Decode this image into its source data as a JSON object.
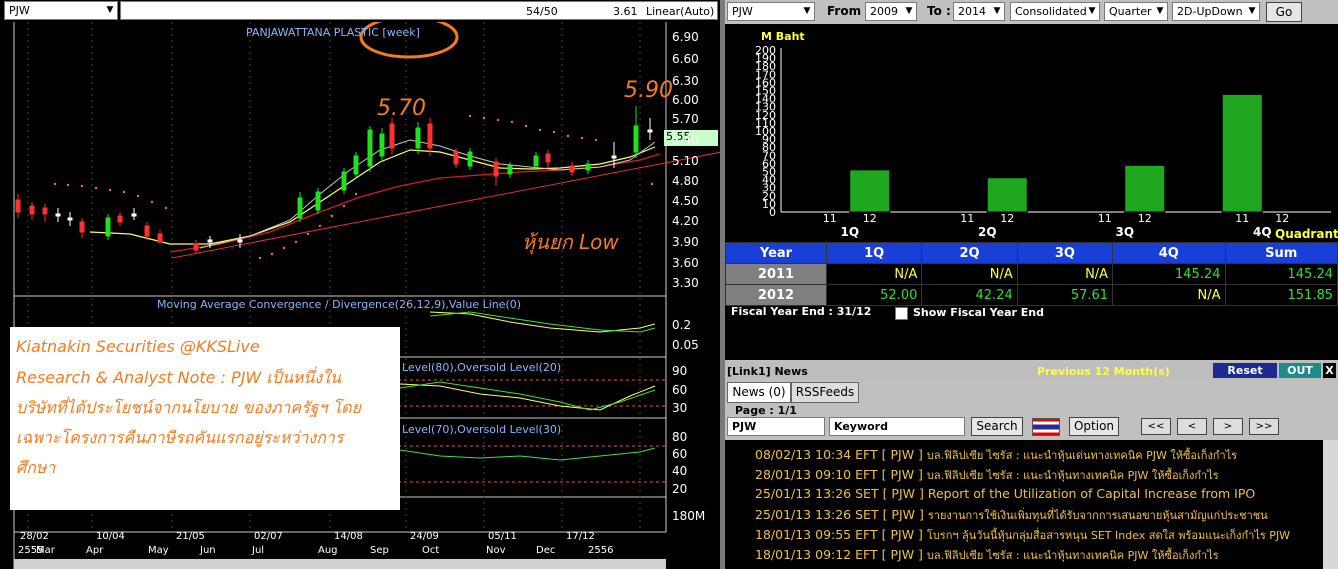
{
  "left": {
    "symbol": "PJW",
    "ratio": "54/50",
    "last": "3.61",
    "scale": "Linear(Auto)",
    "chart_title": "PANJAWATTANA PLASTIC [week]",
    "ann_high1": "5.70",
    "ann_high2": "5.90",
    "ann_low": "หุ้นยก Low",
    "current_price_tag": "5.55",
    "price_ticks": [
      "6.90",
      "6.60",
      "6.30",
      "6.00",
      "5.70",
      "5.40",
      "5.10",
      "4.80",
      "4.50",
      "4.20",
      "3.90",
      "3.60",
      "3.30"
    ],
    "macd_title": "Moving Average Convergence / Divergence(26,12,9),Value Line(0)",
    "macd_ticks": [
      "0.2",
      "0.05"
    ],
    "stoch_title": "Level(80),Oversold Level(20)",
    "stoch_ticks": [
      "90",
      "60",
      "30"
    ],
    "rsi_title": "Level(70),Oversold Level(30)",
    "rsi_ticks": [
      "80",
      "60",
      "40",
      "20"
    ],
    "vol_tick": "180M",
    "date_labels": [
      "28/02",
      "10/04",
      "21/05",
      "02/07",
      "14/08",
      "24/09",
      "05/11",
      "17/12",
      "2556"
    ],
    "month_labels": [
      "2555",
      "Mar",
      "Apr",
      "May",
      "Jun",
      "Jul",
      "Aug",
      "Sep",
      "Oct",
      "Nov",
      "Dec",
      "2556"
    ],
    "note": {
      "line1": "Kiatnakin Securities @KKSLive",
      "line2": "Research & Analyst Note : PJW เป็นหนึ่งใน",
      "line3": "บริษัทที่ได้ประโยชน์จากนโยบาย ของภาครัฐฯ โดย",
      "line4": "เฉพาะโครงการคืนภาษีรถคันแรกอยู่ระหว่างการ",
      "line5": "ศึกษา"
    }
  },
  "right": {
    "toolbar": {
      "symbol": "PJW",
      "from_label": "From :",
      "from_value": "2009",
      "to_label": "To :",
      "to_value": "2014",
      "consolidated": "Consolidated",
      "period": "Quarter",
      "mode": "2D-UpDown",
      "go": "Go"
    },
    "chart_unit": "M Baht",
    "quadrant_label": "Quadrant",
    "year_tick_labels": [
      "11",
      "12"
    ],
    "table": {
      "headers": [
        "Year",
        "1Q",
        "2Q",
        "3Q",
        "4Q",
        "Sum"
      ],
      "rows": [
        {
          "year": "2011",
          "q1": "N/A",
          "q2": "N/A",
          "q3": "N/A",
          "q4": "145.24",
          "sum": "145.24"
        },
        {
          "year": "2012",
          "q1": "52.00",
          "q2": "42.24",
          "q3": "57.61",
          "q4": "N/A",
          "sum": "151.85"
        }
      ]
    },
    "fiscal_label": "Fiscal Year End : 31/12",
    "show_fiscal": "Show Fiscal Year End",
    "news": {
      "title": "[Link1] News",
      "previous": "Previous 12 Month(s)",
      "reset": "Reset",
      "out": "OUT",
      "close": "X",
      "tab_news": "News (0)",
      "tab_rss": "RSSFeeds",
      "page": "Page : 1/1",
      "symbol": "PJW",
      "keyword": "Keyword",
      "search": "Search",
      "option": "Option",
      "items": [
        {
          "date": "08/02/13 10:34",
          "src": "EFT",
          "sym": "[ PJW ]",
          "text": "บล.ฟิลิปเซีย ไซรัส : แนะนำหุ้นเด่นทางเทคนิค PJW ให้ซื้อเก็งกำไร"
        },
        {
          "date": "28/01/13 09:10",
          "src": "EFT",
          "sym": "[ PJW ]",
          "text": "บล.ฟิลิปเซีย ไซรัส : แนะนำหุ้นทางเทคนิค PJW ให้ซื้อเก็งกำไร"
        },
        {
          "date": "25/01/13 13:26",
          "src": "SET",
          "sym": "[ PJW ]",
          "text": "Report of the Utilization of Capital Increase from IPO"
        },
        {
          "date": "25/01/13 13:26",
          "src": "SET",
          "sym": "[ PJW ]",
          "text": "รายงานการใช้เงินเพิ่มทุนที่ได้รับจากการเสนอขายหุ้นสามัญแก่ประชาชน"
        },
        {
          "date": "18/01/13 09:55",
          "src": "EFT",
          "sym": "[ PJW ]",
          "text": "โบรกฯ ลุ้นวันนี้หุ้นกลุ่มสื่อสารหนุน SET Index สดใส พร้อมแนะเก็งกำไร PJW"
        },
        {
          "date": "18/01/13 09:12",
          "src": "EFT",
          "sym": "[ PJW ]",
          "text": "บล.ฟิลิปเซีย ไซรัส : แนะนำหุ้นทางเทคนิค PJW ให้ซื้อเก็งกำไร"
        }
      ]
    }
  },
  "chart_data": {
    "type": "bar",
    "categories": [
      "1Q",
      "2Q",
      "3Q",
      "4Q"
    ],
    "series": [
      {
        "name": "11",
        "values": [
          null,
          null,
          null,
          145.24
        ]
      },
      {
        "name": "12",
        "values": [
          52.0,
          42.24,
          57.61,
          null
        ]
      }
    ],
    "ylabel": "M Baht",
    "ylim": [
      0,
      200
    ],
    "yticks": [
      "0",
      "10",
      "20",
      "30",
      "40",
      "50",
      "60",
      "70",
      "80",
      "90",
      "100",
      "110",
      "120",
      "130",
      "140",
      "150",
      "160",
      "170",
      "180",
      "190",
      "200"
    ],
    "bar_color": "#1fa81f",
    "grid": false
  }
}
